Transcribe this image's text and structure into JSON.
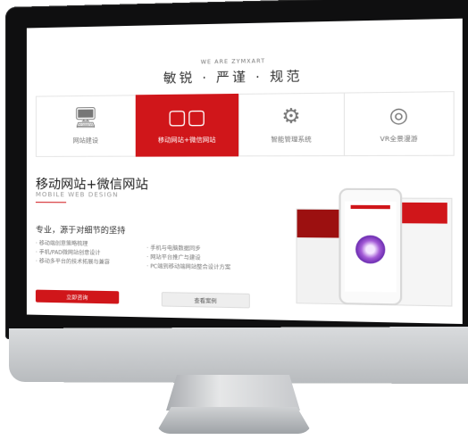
{
  "header": {
    "subtitle": "WE ARE ZYMXART",
    "slogan": "敏锐 · 严谨 · 规范"
  },
  "tabs": [
    {
      "label": "网站建设",
      "icon": "monitor-icon",
      "active": false
    },
    {
      "label": "移动网站+微信网站",
      "icon": "devices-icon",
      "active": true
    },
    {
      "label": "智能管理系统",
      "icon": "gears-icon",
      "active": false
    },
    {
      "label": "VR全景漫游",
      "icon": "target-icon",
      "active": false
    }
  ],
  "section": {
    "title": "移动网站+微信网站",
    "title_en": "MOBILE WEB DESIGN",
    "subtitle": "专业，源于对细节的坚持"
  },
  "features_left": [
    "· 移动端创意策略梳理",
    "· 手机/PAD微网站创意设计",
    "· 移动多平台的技术拓展与兼容"
  ],
  "features_right": [
    "· 手机与电脑数据同步",
    "· 网站平台推广与建设",
    "· PC端到移动端网站整合设计方案"
  ],
  "buttons": {
    "primary": "立即咨询",
    "secondary": "查看案例"
  },
  "colors": {
    "accent": "#d0161a",
    "bezel": "#0f0f10",
    "chin": "#cfd1d3"
  }
}
